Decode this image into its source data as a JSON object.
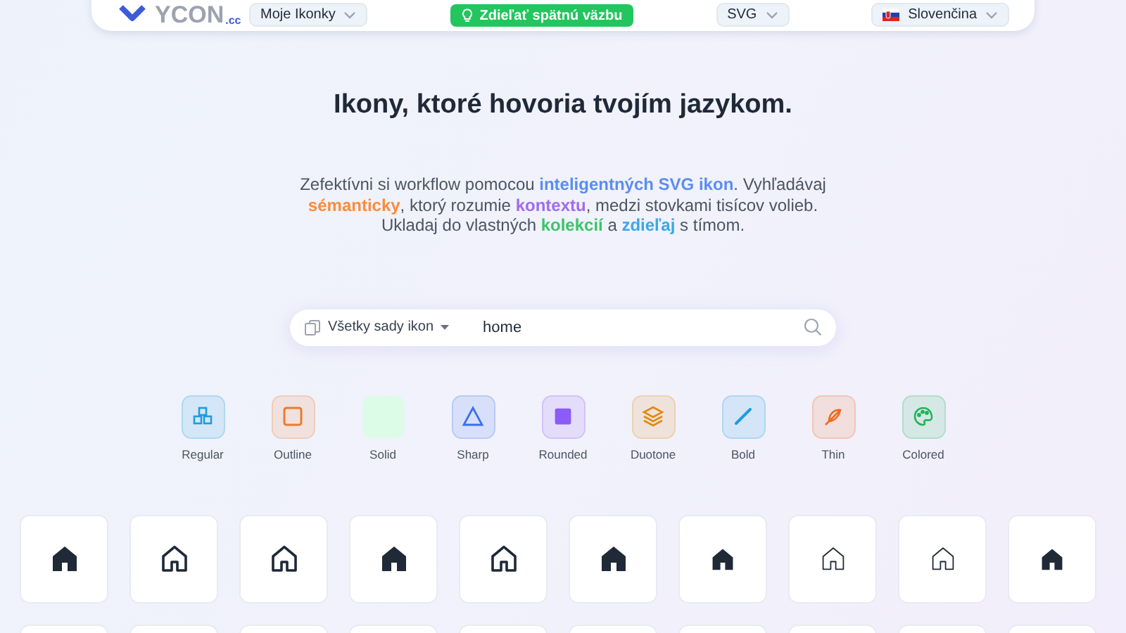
{
  "header": {
    "logo": {
      "text": "YCON",
      "suffix": ".cc"
    },
    "collections_menu": {
      "label": "Moje Ikonky"
    },
    "feedback_button": {
      "label": "Zdieľať spätnú väzbu"
    },
    "format_menu": {
      "label": "SVG"
    },
    "language_menu": {
      "label": "Slovenčina"
    }
  },
  "hero": {
    "title": "Ikony, ktoré hovoria tvojím jazykom.",
    "description": [
      {
        "text": "Zefektívni si workflow pomocou "
      },
      {
        "text": "inteligentných SVG ikon",
        "color": "#5b8def"
      },
      {
        "text": ". Vyhľadávaj "
      },
      {
        "text": "sémanticky",
        "color": "#fb8c3c"
      },
      {
        "text": ", ktorý rozumie "
      },
      {
        "text": "kontextu",
        "color": "#a06cf0"
      },
      {
        "text": ", medzi stovkami tisícov volieb. Ukladaj do vlastných "
      },
      {
        "text": "kolekcií",
        "color": "#3cc46a"
      },
      {
        "text": " a "
      },
      {
        "text": "zdieľaj",
        "color": "#3aa8e8"
      },
      {
        "text": " s tímom."
      }
    ]
  },
  "search": {
    "scope": "Všetky sady ikon",
    "value": "home"
  },
  "styles": [
    {
      "label": "Regular",
      "kind": "cubes",
      "color": "#1e9be0"
    },
    {
      "label": "Outline",
      "kind": "square",
      "color": "#f07a2a"
    },
    {
      "label": "Solid",
      "kind": "solid",
      "color": "#dcfce7"
    },
    {
      "label": "Sharp",
      "kind": "triangle",
      "color": "#3b6ff0"
    },
    {
      "label": "Rounded",
      "kind": "filled-square",
      "color": "#8b5cf6"
    },
    {
      "label": "Duotone",
      "kind": "layers",
      "color": "#e08a10"
    },
    {
      "label": "Bold",
      "kind": "line",
      "color": "#1e9be0"
    },
    {
      "label": "Thin",
      "kind": "feather",
      "color": "#f06a20"
    },
    {
      "label": "Colored",
      "kind": "palette",
      "color": "#22b35a"
    }
  ],
  "results": [
    {
      "kind": "filled"
    },
    {
      "kind": "outline"
    },
    {
      "kind": "outline"
    },
    {
      "kind": "filled"
    },
    {
      "kind": "outline"
    },
    {
      "kind": "filled"
    },
    {
      "kind": "filled-small"
    },
    {
      "kind": "thin"
    },
    {
      "kind": "thin"
    },
    {
      "kind": "filled-small"
    }
  ]
}
